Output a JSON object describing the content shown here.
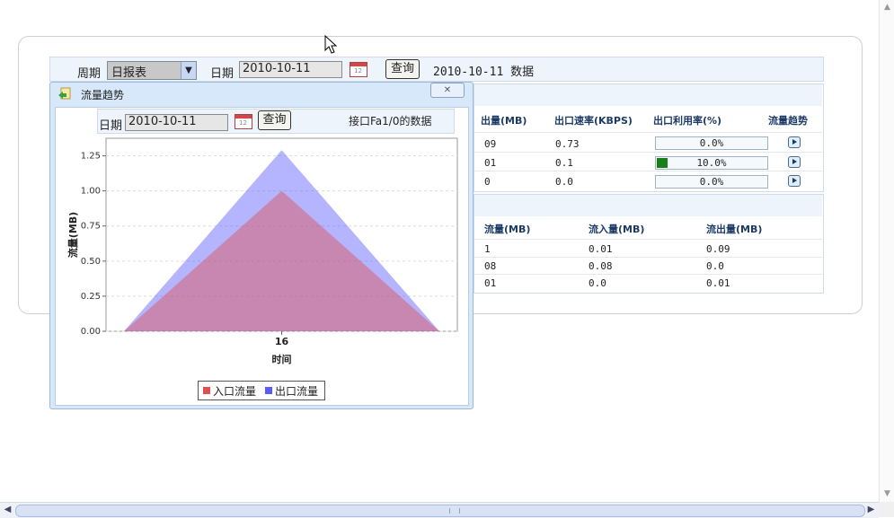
{
  "query": {
    "period_label": "周期",
    "period_value": "日报表",
    "date_label": "日期",
    "date_value": "2010-10-11",
    "query_button": "查询",
    "result_title": "2010-10-11 数据"
  },
  "table1": {
    "headers": [
      "出量(MB)",
      "出口速率(KBPS)",
      "出口利用率(%)",
      "流量趋势"
    ],
    "rows": [
      {
        "out": "09",
        "rate": "0.73",
        "util": "0.0%",
        "util_fraction": 0.0
      },
      {
        "out": "01",
        "rate": "0.1",
        "util": "10.0%",
        "util_fraction": 0.1
      },
      {
        "out": "0",
        "rate": "0.0",
        "util": "0.0%",
        "util_fraction": 0.0
      }
    ]
  },
  "table2": {
    "headers": [
      "流量(MB)",
      "流入量(MB)",
      "流出量(MB)"
    ],
    "rows": [
      [
        "1",
        "0.01",
        "0.09"
      ],
      [
        "08",
        "0.08",
        "0.0"
      ],
      [
        "01",
        "0.0",
        "0.01"
      ]
    ]
  },
  "popup": {
    "title": "流量趋势",
    "date_label": "日期",
    "date_value": "2010-10-11",
    "query_button": "查询",
    "interface_text": "接口Fa1/0的数据"
  },
  "chart_data": {
    "type": "area",
    "title": "",
    "xlabel": "时间",
    "ylabel": "流量(MB)",
    "categories": [
      "16"
    ],
    "ylim": [
      0,
      1.375
    ],
    "yticks": [
      "0.00",
      "0.25",
      "0.50",
      "0.75",
      "1.00",
      "1.25"
    ],
    "grid": true,
    "legend_position": "bottom",
    "series": [
      {
        "name": "入口流量",
        "color": "#e05050",
        "values": [
          1.0
        ]
      },
      {
        "name": "出口流量",
        "color": "#5a5aff",
        "values": [
          1.29
        ]
      }
    ]
  },
  "colors": {
    "panel_bg": "#eef4fb",
    "header_text": "#1d3a66",
    "util_fill": "#188018"
  }
}
